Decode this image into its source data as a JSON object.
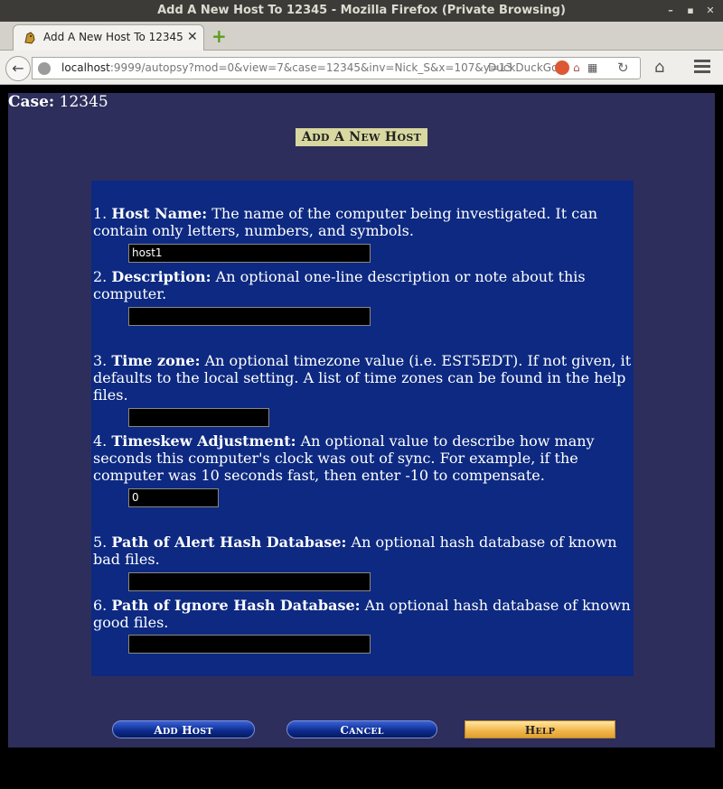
{
  "window": {
    "title": "Add A New Host To 12345 - Mozilla Firefox (Private Browsing)"
  },
  "tab": {
    "label": "Add A New Host To 12345",
    "close": "✕",
    "new_tab": "+"
  },
  "navbar": {
    "url_host": "localhost",
    "url_rest": ":9999/autopsy?mod=0&view=7&case=12345&inv=Nick_S&x=107&y=13",
    "search_engine": "DuckDuckGo"
  },
  "page": {
    "case_label": "Case:",
    "case_value": "12345",
    "heading_first": "A",
    "heading_rest1": "DD",
    "heading_a2": " A ",
    "heading_n": "N",
    "heading_rest2": "EW",
    "heading_h": " H",
    "heading_rest3": "OST"
  },
  "form": {
    "fields": [
      {
        "number": "1.",
        "label": "Host Name:",
        "description": " The name of the computer being investigated. It can contain only letters, numbers, and symbols.",
        "value": "host1"
      },
      {
        "number": "2.",
        "label": "Description:",
        "description": " An optional one-line description or note about this computer.",
        "value": ""
      },
      {
        "number": "3.",
        "label": "Time zone:",
        "description": " An optional timezone value (i.e. EST5EDT). If not given, it defaults to the local setting. A list of time zones can be found in the help files.",
        "value": ""
      },
      {
        "number": "4.",
        "label": "Timeskew Adjustment:",
        "description": " An optional value to describe how many seconds this computer's clock was out of sync. For example, if the computer was 10 seconds fast, then enter -10 to compensate.",
        "value": "0"
      },
      {
        "number": "5.",
        "label": "Path of Alert Hash Database:",
        "description": " An optional hash database of known bad files.",
        "value": ""
      },
      {
        "number": "6.",
        "label": "Path of Ignore Hash Database:",
        "description": " An optional hash database of known good files.",
        "value": ""
      }
    ]
  },
  "buttons": {
    "add_host": {
      "cap1": "A",
      "rest1": "DD",
      "cap2": " H",
      "rest2": "OST"
    },
    "cancel": {
      "cap1": "C",
      "rest1": "ANCEL"
    },
    "help": {
      "cap1": "H",
      "rest1": "ELP"
    }
  },
  "colors": {
    "page_bg": "#2e2e5c",
    "form_bg": "#0d2981",
    "heading_bg": "#d8d8a0",
    "help_button": "#f1b54a"
  }
}
